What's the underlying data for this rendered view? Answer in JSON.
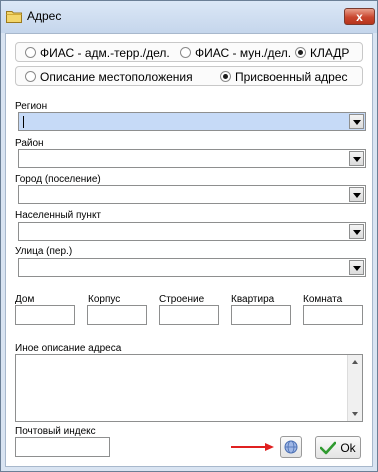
{
  "window": {
    "title": "Адрес",
    "close_label": "x"
  },
  "source_options": [
    {
      "label": "ФИАС - адм.-терр./дел.",
      "selected": false
    },
    {
      "label": "ФИАС - мун./дел.",
      "selected": false
    },
    {
      "label": "КЛАДР",
      "selected": true
    }
  ],
  "address_mode_options": [
    {
      "label": "Описание местоположения",
      "selected": false
    },
    {
      "label": "Присвоенный адрес",
      "selected": true
    }
  ],
  "fields": {
    "region": {
      "label": "Регион",
      "value": ""
    },
    "district": {
      "label": "Район",
      "value": ""
    },
    "city": {
      "label": "Город (поселение)",
      "value": ""
    },
    "settlement": {
      "label": "Населенный пункт",
      "value": ""
    },
    "street": {
      "label": "Улица (пер.)",
      "value": ""
    },
    "house": {
      "label": "Дом",
      "value": ""
    },
    "building": {
      "label": "Корпус",
      "value": ""
    },
    "structure": {
      "label": "Строение",
      "value": ""
    },
    "apartment": {
      "label": "Квартира",
      "value": ""
    },
    "room": {
      "label": "Комната",
      "value": ""
    },
    "other_description": {
      "label": "Иное описание адреса",
      "value": ""
    },
    "postal_code": {
      "label": "Почтовый индекс",
      "value": ""
    }
  },
  "buttons": {
    "ok_label": "Ok"
  },
  "colors": {
    "focus_field": "#c6daf7",
    "accent_arrow": "#e02020",
    "title_bar": "#c5d6ec"
  },
  "icons": {
    "window": "folder-icon",
    "action": "globe-icon",
    "ok": "checkmark-icon",
    "annotation": "red-arrow-icon"
  }
}
